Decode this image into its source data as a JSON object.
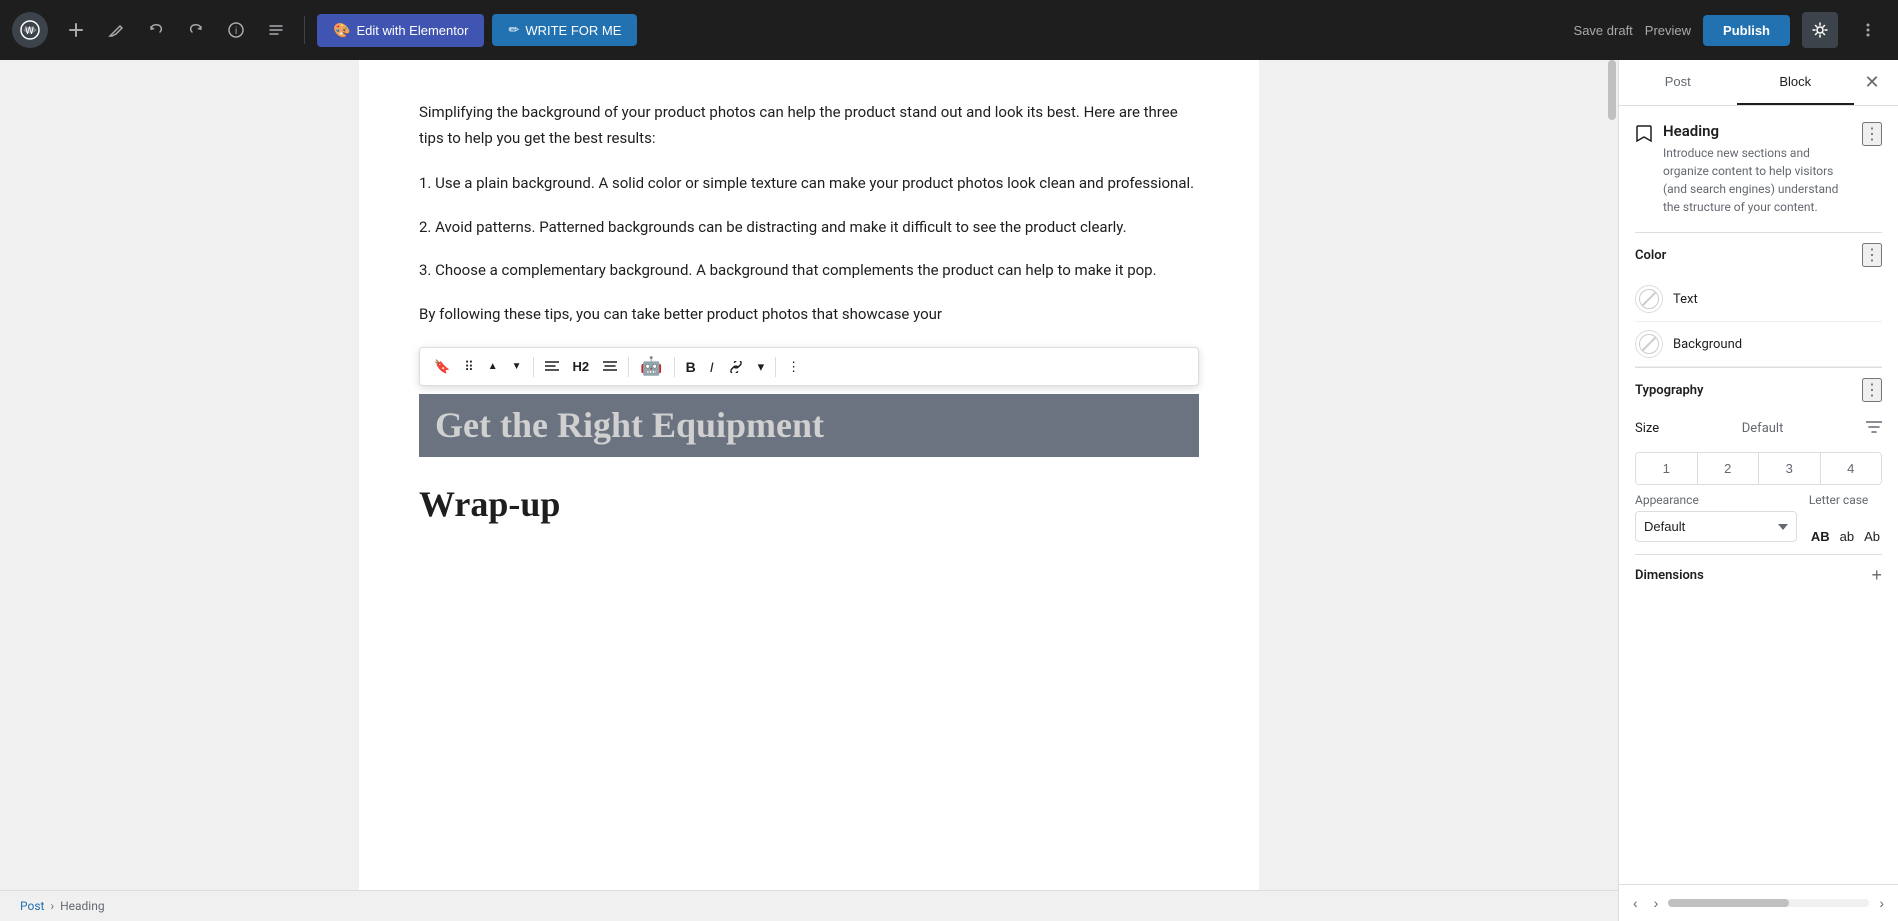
{
  "topbar": {
    "wp_icon": "W",
    "add_label": "+",
    "pen_icon": "✏",
    "undo_icon": "↩",
    "redo_icon": "↪",
    "info_icon": "ℹ",
    "menu_icon": "≡",
    "elementor_label": "Edit with Elementor",
    "write_label": "WRITE FOR ME",
    "save_draft_label": "Save draft",
    "preview_label": "Preview",
    "publish_label": "Publish",
    "settings_icon": "⚙",
    "more_icon": "⋮"
  },
  "editor": {
    "para1": "Simplifying the background of your product photos can help the product stand out and look its best. Here are three tips to help you get the best results:",
    "tip1": "1. Use a plain background. A solid color or simple texture can make your product photos look clean and professional.",
    "tip2": "2. Avoid patterns. Patterned backgrounds can be distracting and make it difficult to see the product clearly.",
    "tip3": "3. Choose a complementary background. A background that complements the product can help to make it pop.",
    "partial_text": "By following these tips, you can take better product photos that showcase your",
    "selected_heading": "Get the Right Equipment",
    "wrapup_heading": "Wrap-up"
  },
  "floating_toolbar": {
    "bookmark_icon": "🔖",
    "drag_icon": "⠿",
    "move_up_icon": "▲",
    "move_down_icon": "▼",
    "align_icon": "≡",
    "h2_label": "H2",
    "align2_icon": "≡",
    "ai_icon": "🤖",
    "bold_label": "B",
    "italic_label": "I",
    "link_icon": "🔗",
    "more_icon": "▾",
    "options_icon": "⋮"
  },
  "breadcrumb": {
    "post_label": "Post",
    "separator": "›",
    "heading_label": "Heading"
  },
  "sidebar": {
    "post_tab": "Post",
    "block_tab": "Block",
    "close_icon": "✕",
    "block_icon": "🔖",
    "block_title": "Heading",
    "block_desc": "Introduce new sections and organize content to help visitors (and search engines) understand the structure of your content.",
    "more_icon": "⋮",
    "color_section_title": "Color",
    "text_label": "Text",
    "background_label": "Background",
    "typography_section_title": "Typography",
    "size_label": "Size",
    "size_default": "Default",
    "size_filter_icon": "⊟",
    "size_options": [
      "1",
      "2",
      "3",
      "4"
    ],
    "appearance_label": "Appearance",
    "appearance_default": "Default",
    "letter_case_label": "Letter case",
    "letter_case_options": [
      "AB",
      "ab",
      "Ab"
    ],
    "dimensions_label": "Dimensions",
    "dimensions_add_icon": "+"
  }
}
